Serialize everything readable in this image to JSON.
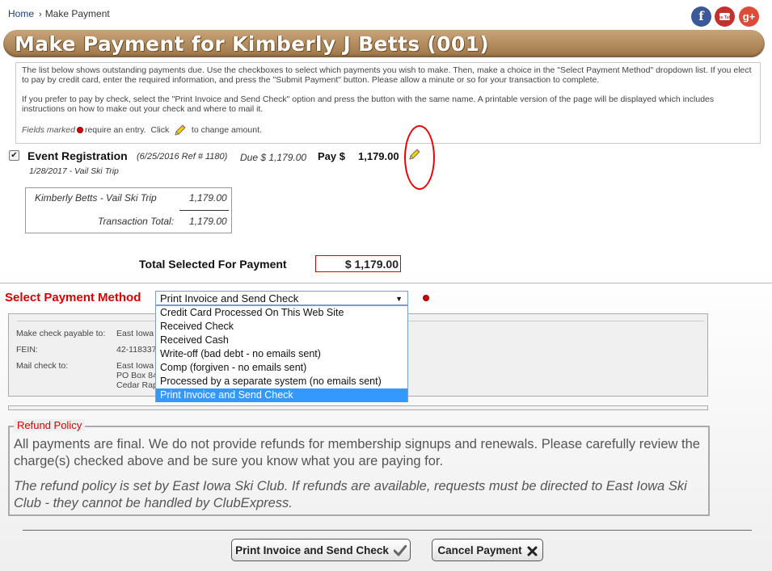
{
  "breadcrumb": {
    "home": "Home",
    "separator": "›",
    "current": "Make Payment"
  },
  "social": {
    "facebook": "f",
    "youtube": "You Tube",
    "googleplus": "g+"
  },
  "title": "Make Payment for Kimberly J Betts (001)",
  "instructions": {
    "p1": "The list below shows outstanding payments due. Use the checkboxes to select which payments you wish to make. Then, make a choice in the \"Select Payment Method\" dropdown list. If you elect to pay by credit card, enter the required information, and press the \"Submit Payment\" button. Please allow a minute or so for your transaction to complete.",
    "p2": "If you prefer to pay by check, select the \"Print Invoice and Send Check\" option and press the button with the same name. A printable version of the page will be displayed which includes instructions on how to make out your check and where to mail it.",
    "fields_marked": "Fields marked",
    "require_entry": "require an entry.",
    "click": "Click",
    "to_change": "to change amount."
  },
  "registration": {
    "checked": true,
    "title": "Event Registration",
    "meta": "(6/25/2016  Ref # 1180)",
    "due": "Due $ 1,179.00",
    "pay_label": "Pay $",
    "pay_amount": "1,179.00",
    "date": "1/28/2017 - Vail Ski Trip",
    "line_item": "Kimberly Betts - Vail Ski Trip",
    "line_amount": "1,179.00",
    "total_label": "Transaction Total:",
    "total_amount": "1,179.00"
  },
  "total_selected": {
    "label": "Total Selected For Payment",
    "value": "$ 1,179.00"
  },
  "payment_method": {
    "label": "Select Payment Method",
    "selected": "Print Invoice and Send Check",
    "options": [
      "Credit Card Processed On This Web Site",
      "Received Check",
      "Received Cash",
      "Write-off (bad debt - no emails sent)",
      "Comp (forgiven - no emails sent)",
      "Processed by a separate system (no emails sent)",
      "Print Invoice and Send Check"
    ]
  },
  "check_details": {
    "payable_label": "Make check payable to:",
    "payable_value": "East Iowa",
    "fein_label": "FEIN:",
    "fein_value": "42-118337",
    "mail_label": "Mail check to:",
    "mail_line1": "East Iowa",
    "mail_line2": "PO Box 84",
    "mail_line3": "Cedar Rap"
  },
  "refund": {
    "legend": "Refund Policy",
    "text1": "All payments are final. We do not provide refunds for membership signups and renewals. Please carefully review the charge(s) checked above and be sure you know what you are paying for.",
    "text2": "The refund policy is set by East Iowa Ski Club. If refunds are available, requests must be directed to East Iowa Ski Club - they cannot be handled by ClubExpress."
  },
  "buttons": {
    "print": "Print Invoice and Send Check",
    "cancel": "Cancel Payment"
  },
  "colors": {
    "accent_red": "#dd0000",
    "banner": "#b08a5c",
    "selected_option": "#3399ff"
  }
}
